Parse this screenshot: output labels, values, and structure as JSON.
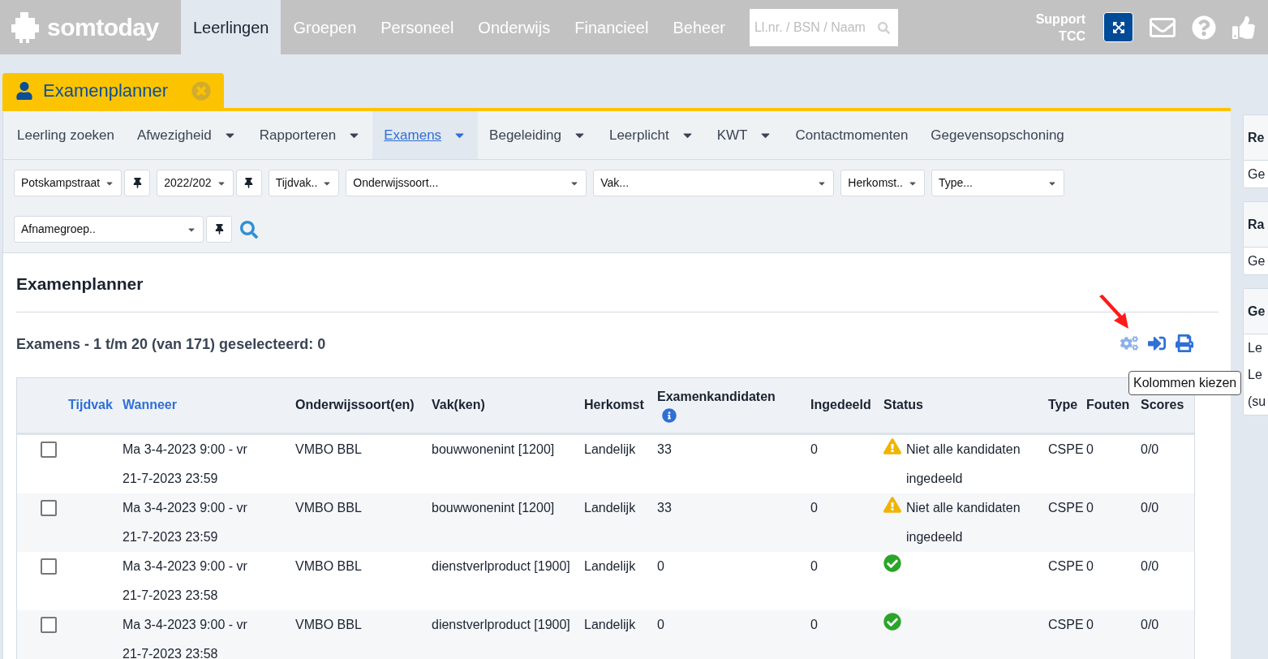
{
  "topbar": {
    "logo": "somtoday",
    "nav": [
      {
        "label": "Leerlingen",
        "selected": true
      },
      {
        "label": "Groepen",
        "selected": false
      },
      {
        "label": "Personeel",
        "selected": false
      },
      {
        "label": "Onderwijs",
        "selected": false
      },
      {
        "label": "Financieel",
        "selected": false
      },
      {
        "label": "Beheer",
        "selected": false
      }
    ],
    "search": {
      "placeholder": "Ll.nr. / BSN / Naam"
    },
    "support": [
      "Support",
      "TCC"
    ]
  },
  "page_tab": {
    "label": "Examenplanner"
  },
  "menu": [
    {
      "label": "Leerling zoeken",
      "selected": false,
      "dropdown": false
    },
    {
      "label": "Afwezigheid",
      "selected": false,
      "dropdown": true
    },
    {
      "label": "Rapporteren",
      "selected": false,
      "dropdown": true
    },
    {
      "label": "Examens",
      "selected": true,
      "dropdown": true
    },
    {
      "label": "Begeleiding",
      "selected": false,
      "dropdown": true
    },
    {
      "label": "Leerplicht",
      "selected": false,
      "dropdown": true
    },
    {
      "label": "KWT",
      "selected": false,
      "dropdown": true
    },
    {
      "label": "Contactmomenten",
      "selected": false,
      "dropdown": false
    },
    {
      "label": "Gegevensopschoning",
      "selected": false,
      "dropdown": false
    }
  ],
  "filters": [
    {
      "value": "Potskampstraat",
      "pin": true,
      "kind": "narrow"
    },
    {
      "value": "2022/202",
      "pin": true,
      "kind": "narrow"
    },
    {
      "value": "Tijdvak..",
      "pin": false,
      "kind": "narrow"
    },
    {
      "value": "Onderwijssoort...",
      "pin": false,
      "kind": "wide"
    },
    {
      "value": "Vak...",
      "pin": false,
      "kind": "wide"
    },
    {
      "value": "Herkomst..",
      "pin": false,
      "kind": "narrow"
    },
    {
      "value": "Type...",
      "pin": false,
      "kind": "medium"
    },
    {
      "value": "Afnamegroep..",
      "pin": true,
      "kind": "large"
    }
  ],
  "heading": "Examenplanner",
  "summary": "Examens - 1 t/m 20 (van 171) geselecteerd: 0",
  "tooltip": "Kolommen kiezen",
  "table": {
    "columns": [
      {
        "label": "Tijdvak",
        "sortable": true
      },
      {
        "label": "Wanneer",
        "sortable": true
      },
      {
        "label": "Onderwijssoort(en)",
        "sortable": false
      },
      {
        "label": "Vak(ken)",
        "sortable": false
      },
      {
        "label": "Herkomst",
        "sortable": false
      },
      {
        "label": "Examenkandidaten",
        "sortable": false,
        "info": true
      },
      {
        "label": "Ingedeeld",
        "sortable": false
      },
      {
        "label": "Status",
        "sortable": false
      },
      {
        "label": "Type",
        "sortable": false
      },
      {
        "label": "Fouten",
        "sortable": false
      },
      {
        "label": "Scores",
        "sortable": false
      }
    ],
    "rows": [
      {
        "checked": false,
        "wanneer": "Ma 3-4-2023 9:00 - vr 21-7-2023 23:59",
        "onderwijssoort": "VMBO BBL",
        "vak": "bouwwonenint [1200]",
        "herkomst": "Landelijk",
        "kandidaten": "33",
        "ingedeeld": "0",
        "status": {
          "kind": "warning",
          "text": "Niet alle kandidaten ingedeeld"
        },
        "type": "CSPE",
        "fouten": "0",
        "scores": "0/0"
      },
      {
        "checked": false,
        "wanneer": "Ma 3-4-2023 9:00 - vr 21-7-2023 23:59",
        "onderwijssoort": "VMBO BBL",
        "vak": "bouwwonenint [1200]",
        "herkomst": "Landelijk",
        "kandidaten": "33",
        "ingedeeld": "0",
        "status": {
          "kind": "warning",
          "text": "Niet alle kandidaten ingedeeld"
        },
        "type": "CSPE",
        "fouten": "0",
        "scores": "0/0"
      },
      {
        "checked": false,
        "wanneer": "Ma 3-4-2023 9:00 - vr 21-7-2023 23:58",
        "onderwijssoort": "VMBO BBL",
        "vak": "dienstverlproduct [1900]",
        "herkomst": "Landelijk",
        "kandidaten": "0",
        "ingedeeld": "0",
        "status": {
          "kind": "ok"
        },
        "type": "CSPE",
        "fouten": "0",
        "scores": "0/0"
      },
      {
        "checked": false,
        "wanneer": "Ma 3-4-2023 9:00 - vr 21-7-2023 23:58",
        "onderwijssoort": "VMBO BBL",
        "vak": "dienstverlproduct [1900]",
        "herkomst": "Landelijk",
        "kandidaten": "0",
        "ingedeeld": "0",
        "status": {
          "kind": "ok"
        },
        "type": "CSPE",
        "fouten": "0",
        "scores": "0/0"
      }
    ]
  },
  "side_cards": [
    {
      "title": "Re",
      "lines": [
        "Ge"
      ]
    },
    {
      "title": "Ra",
      "lines": [
        "Ge"
      ]
    },
    {
      "title": "Ge",
      "lines": [
        "Le",
        "Le",
        "(su"
      ]
    }
  ]
}
